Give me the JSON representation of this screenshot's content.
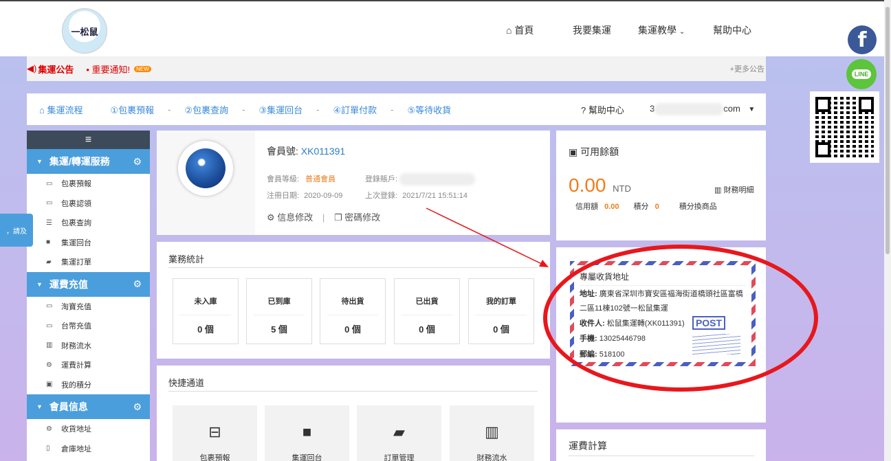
{
  "logo": {
    "text": "一松鼠"
  },
  "nav": {
    "home": "首頁",
    "ship": "我要集運",
    "tutorial": "集運教學",
    "help": "幫助中心"
  },
  "notice": {
    "title": "集運公告",
    "item": "• 重要通知!",
    "new": "NEW",
    "more": "+更多公告"
  },
  "steps": {
    "flow": "集運流程",
    "s1": "①包裹預報",
    "s2": "②包裹查詢",
    "s3": "③集運回台",
    "s4": "④訂單付款",
    "s5": "⑤等待收貨",
    "help": "幫助中心",
    "user_suffix": "com"
  },
  "sidebar": {
    "menu_icon": "≡",
    "side_tab": "，請及",
    "groups": [
      {
        "title": "集運/轉運服務",
        "items": [
          "包裹預報",
          "包裹認領",
          "包裹查詢",
          "集運回台",
          "集運訂單"
        ]
      },
      {
        "title": "運費充值",
        "items": [
          "淘寶充值",
          "台幣充值",
          "財務流水",
          "運費計算",
          "我的積分"
        ]
      },
      {
        "title": "會員信息",
        "items": [
          "收貨地址",
          "倉庫地址"
        ]
      }
    ]
  },
  "profile": {
    "member_no_label": "會員號:",
    "member_no": "XK011391",
    "level_label": "會員等級:",
    "level": "普通會員",
    "account_label": "登錄賬戶:",
    "reg_label": "注冊日期:",
    "reg": "2020-09-09",
    "last_label": "上次登錄:",
    "last": "2021/7/21 15:51:14",
    "edit": "信息修改",
    "pwd": "密碼修改"
  },
  "stats": {
    "title": "業務統計",
    "items": [
      {
        "label": "未入庫",
        "value": "0 個"
      },
      {
        "label": "已到庫",
        "value": "5 個"
      },
      {
        "label": "待出貨",
        "value": "0 個"
      },
      {
        "label": "已出貨",
        "value": "0 個"
      },
      {
        "label": "我的訂單",
        "value": "0 個"
      }
    ]
  },
  "quick": {
    "title": "快捷通道",
    "items": [
      "包裹預報",
      "集運回台",
      "訂單管理",
      "財務流水"
    ]
  },
  "balance": {
    "title": "可用餘額",
    "amount": "0.00",
    "currency": "NTD",
    "detail": "財務明細",
    "credit_label": "信用額",
    "credit": "0.00",
    "points_label": "積分",
    "points": "0",
    "exchange": "積分換商品"
  },
  "address": {
    "title": "專屬收貨地址",
    "addr_label": "地址:",
    "addr": "廣東省深圳市寶安區福海街道橋頭社區富橋二區11棟102號一松鼠集運",
    "recv_label": "收件人:",
    "recv": "松鼠集運轉(XK011391)",
    "phone_label": "手機:",
    "phone": "13025446798",
    "zip_label": "郵編:",
    "zip": "518100",
    "post": "POST"
  },
  "freight": {
    "title": "運費計算"
  }
}
